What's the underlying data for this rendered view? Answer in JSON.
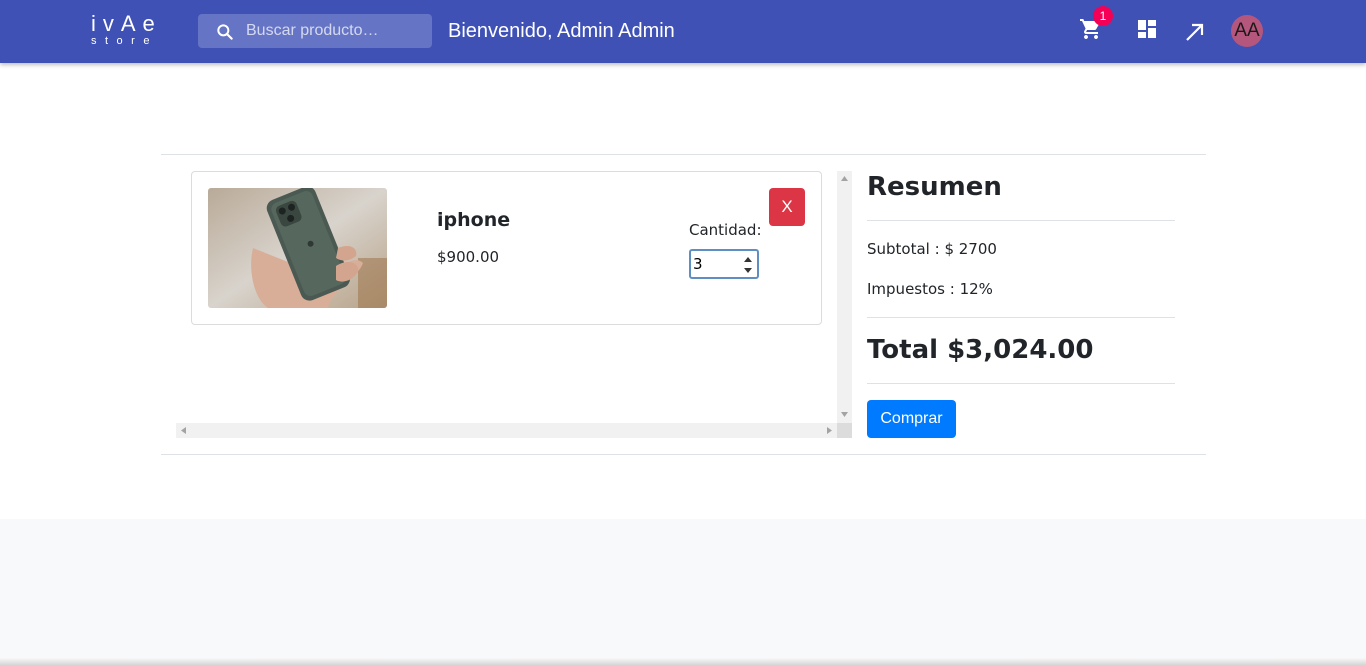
{
  "header": {
    "logo_main": "ivAe",
    "logo_sub": "store",
    "search_placeholder": "Buscar producto…",
    "welcome": "Bienvenido, Admin Admin",
    "cart_count": "1",
    "avatar_initials": "AA",
    "bar_color": "#3f51b5"
  },
  "cart": {
    "items": [
      {
        "name": "iphone",
        "price": "$900.00",
        "quantity_label": "Cantidad:",
        "quantity": "3",
        "remove_label": "X"
      }
    ]
  },
  "summary": {
    "title": "Resumen",
    "subtotal": "Subtotal : $ 2700",
    "tax": "Impuestos : 12%",
    "total": "Total $3,024.00",
    "buy_label": "Comprar"
  },
  "icons": [
    "search-icon",
    "cart-icon",
    "dashboard-icon",
    "arrow-up-right-icon",
    "scroll-arrow-icon"
  ],
  "colors": {
    "danger": "#dc3545",
    "primary": "#007bff",
    "badge": "#f50057"
  }
}
